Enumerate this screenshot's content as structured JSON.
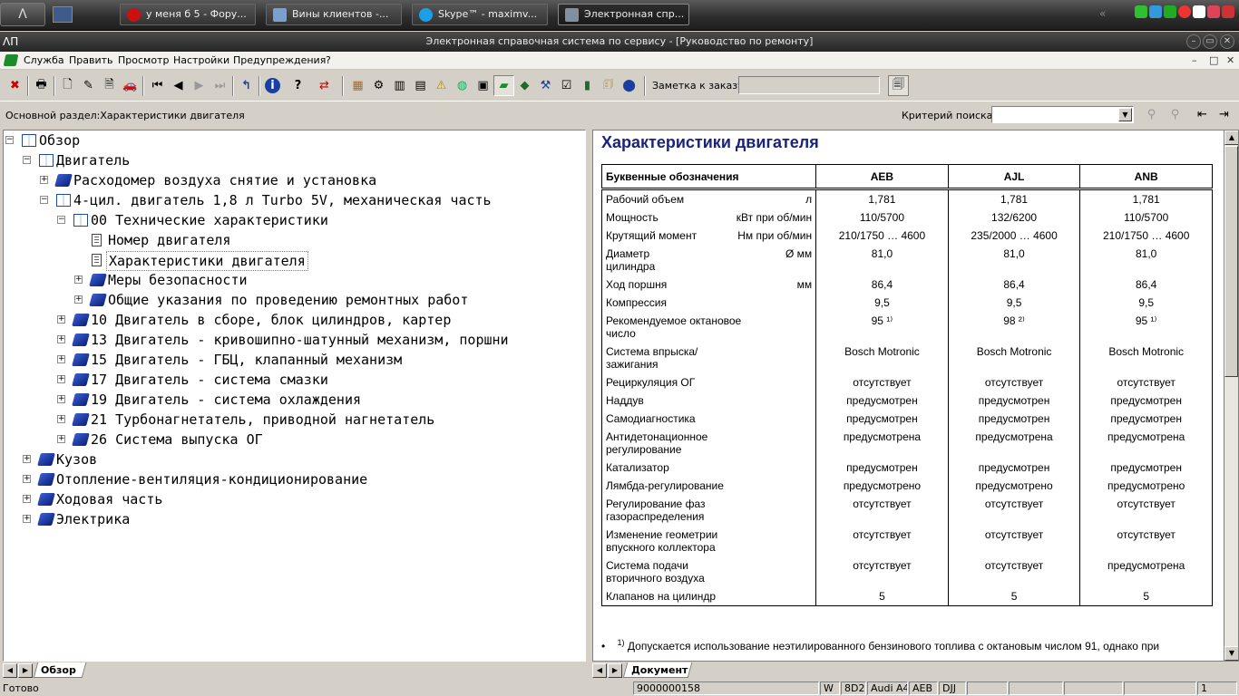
{
  "taskbar": {
    "start_label": "Λ",
    "buttons": [
      {
        "label": "у меня б 5 - Фору...",
        "color": "#cc1010"
      },
      {
        "label": "Вины  клиентов -...",
        "color": "#7aa0d0"
      },
      {
        "label": "Skype™ - maximv...",
        "color": "#1aa0e8"
      },
      {
        "label": "Электронная спр...",
        "color": "#8090a0"
      }
    ]
  },
  "window": {
    "title": "Электронная справочная система по сервису - [Руководство по ремонту]",
    "app_icon": "ΛΠ"
  },
  "menu": [
    "Служба",
    "Править",
    "Просмотр",
    "Настройки",
    "Предупреждения",
    "?"
  ],
  "toolbar": {
    "order_note_label": "Заметка к заказу:",
    "order_note_value": ""
  },
  "pathbar": {
    "section": "Основной раздел:Характеристики двигателя",
    "search_label": "Критерий  поиска:",
    "search_value": ""
  },
  "tree": [
    {
      "label": "Обзор"
    },
    {
      "label": "Двигатель"
    },
    {
      "label": "Расходомер воздуха снятие и установка"
    },
    {
      "label": "4-цил. двигатель 1,8 л Turbo 5V, механическая часть"
    },
    {
      "label": "00 Технические характеристики"
    },
    {
      "label": "Номер двигателя"
    },
    {
      "label": "Характеристики двигателя"
    },
    {
      "label": "Меры безопасности"
    },
    {
      "label": "Общие указания по проведению ремонтных работ"
    },
    {
      "label": "10 Двигатель в сборе, блок цилиндров, картер"
    },
    {
      "label": "13 Двигатель - кривошипно-шатунный механизм, поршни"
    },
    {
      "label": "15 Двигатель - ГБЦ, клапанный механизм"
    },
    {
      "label": "17 Двигатель - система смазки"
    },
    {
      "label": "19 Двигатель - система охлаждения"
    },
    {
      "label": "21 Турбонагнетатель, приводной нагнетатель"
    },
    {
      "label": "26 Система выпуска ОГ"
    },
    {
      "label": "Кузов"
    },
    {
      "label": "Отопление-вентиляция-кондиционирование"
    },
    {
      "label": "Ходовая часть"
    },
    {
      "label": "Электрика"
    }
  ],
  "left_tab": "Обзор",
  "right_tab": "Документ",
  "doc": {
    "title": "Характеристики двигателя",
    "headers": [
      "Буквенные обозначения",
      "AEB",
      "AJL",
      "ANB"
    ],
    "rows": [
      {
        "label": "Рабочий объем",
        "unit": "л",
        "v": [
          "1,781",
          "1,781",
          "1,781"
        ]
      },
      {
        "label": "Мощность",
        "unit": "кВт при об/мин",
        "v": [
          "110/5700",
          "132/6200",
          "110/5700"
        ]
      },
      {
        "label": "Крутящий момент",
        "unit": "Нм при об/мин",
        "v": [
          "210/1750 … 4600",
          "235/2000 … 4600",
          "210/1750 … 4600"
        ]
      },
      {
        "label": "Диаметр цилиндра",
        "unit": "Ø мм",
        "v": [
          "81,0",
          "81,0",
          "81,0"
        ]
      },
      {
        "label": "Ход поршня",
        "unit": "мм",
        "v": [
          "86,4",
          "86,4",
          "86,4"
        ]
      },
      {
        "label": "Компрессия",
        "unit": "",
        "v": [
          "9,5",
          "9,5",
          "9,5"
        ]
      },
      {
        "label": "Рекомендуемое октановое число",
        "unit": "",
        "v": [
          "95 ¹⁾",
          "98 ²⁾",
          "95 ¹⁾"
        ]
      },
      {
        "label": "Система впрыска/зажигания",
        "unit": "",
        "v": [
          "Bosch Motronic",
          "Bosch Motronic",
          "Bosch Motronic"
        ]
      },
      {
        "label": "Рециркуляция ОГ",
        "unit": "",
        "v": [
          "отсутствует",
          "отсутствует",
          "отсутствует"
        ]
      },
      {
        "label": "Наддув",
        "unit": "",
        "v": [
          "предусмотрен",
          "предусмотрен",
          "предусмотрен"
        ]
      },
      {
        "label": "Самодиагностика",
        "unit": "",
        "v": [
          "предусмотрен",
          "предусмотрен",
          "предусмотрен"
        ]
      },
      {
        "label": "Антидетонационное регулирование",
        "unit": "",
        "v": [
          "предусмотрена",
          "предусмотрена",
          "предусмотрена"
        ]
      },
      {
        "label": "Катализатор",
        "unit": "",
        "v": [
          "предусмотрен",
          "предусмотрен",
          "предусмотрен"
        ]
      },
      {
        "label": "Лямбда-регулирование",
        "unit": "",
        "v": [
          "предусмотрено",
          "предусмотрено",
          "предусмотрено"
        ]
      },
      {
        "label": "Регулирование фаз газораспределения",
        "unit": "",
        "v": [
          "отсутствует",
          "отсутствует",
          "отсутствует"
        ]
      },
      {
        "label": "Изменение геометрии впускного коллектора",
        "unit": "",
        "v": [
          "отсутствует",
          "отсутствует",
          "отсутствует"
        ]
      },
      {
        "label": "Система подачи вторичного воздуха",
        "unit": "",
        "v": [
          "отсутствует",
          "отсутствует",
          "предусмотрена"
        ]
      },
      {
        "label": "Клапанов на цилиндр",
        "unit": "",
        "v": [
          "5",
          "5",
          "5"
        ]
      }
    ],
    "footnote_bullet": "•",
    "footnote_mark": "1)",
    "footnote": "Допускается использование неэтилированного бензинового топлива с октановым числом 91, однако при"
  },
  "status": {
    "ready": "Готово",
    "order": "9000000158",
    "mode": "W",
    "code": "8D2",
    "model": "Audi A4",
    "engine": "AEB",
    "gearbox": "DJJ",
    "page": "1"
  }
}
